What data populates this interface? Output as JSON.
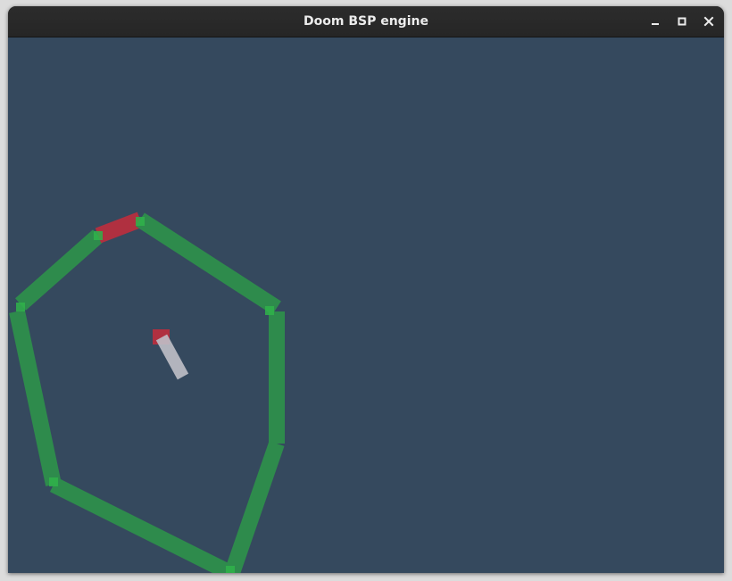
{
  "window": {
    "title": "Doom BSP engine",
    "controls": [
      {
        "name": "minimize-button",
        "icon": "minimize-icon"
      },
      {
        "name": "maximize-button",
        "icon": "maximize-icon"
      },
      {
        "name": "close-button",
        "icon": "close-icon"
      }
    ]
  },
  "scene": {
    "background_color": "#35495e",
    "colors": {
      "solid_wall": "#2e8b4c",
      "vertex": "#2fb34a",
      "portal_wall": "#b03040",
      "player": "#c0c0c8"
    }
  }
}
